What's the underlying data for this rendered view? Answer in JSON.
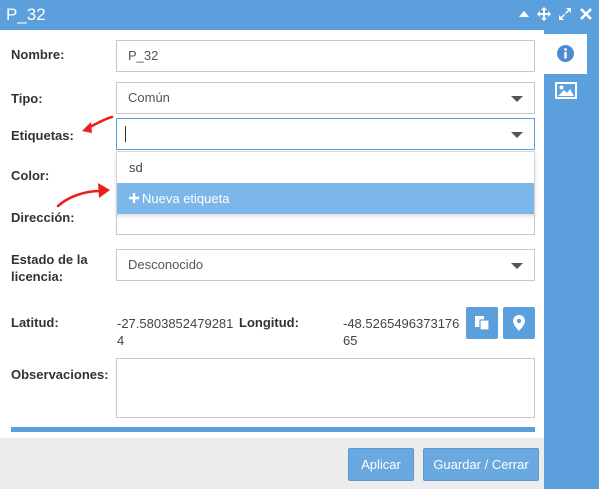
{
  "window": {
    "title": "P_32"
  },
  "form": {
    "nombre": {
      "label": "Nombre:",
      "value": "P_32"
    },
    "tipo": {
      "label": "Tipo:",
      "value": "Común"
    },
    "etiquetas": {
      "label": "Etiquetas:",
      "value": ""
    },
    "color": {
      "label": "Color:"
    },
    "direccion": {
      "label": "Dirección:"
    },
    "estado": {
      "label_line1": "Estado de la",
      "label_line2": "licencia:",
      "value": "Desconocido"
    },
    "latitud": {
      "label": "Latitud:",
      "value": "-27.58038524792814"
    },
    "longitud": {
      "label": "Longitud:",
      "value": "-48.526549637317665"
    },
    "observaciones": {
      "label": "Observaciones:",
      "value": ""
    }
  },
  "dropdown": {
    "items": [
      {
        "label": "sd"
      },
      {
        "label": "Nueva etiqueta",
        "icon": "plus-icon"
      }
    ]
  },
  "footer": {
    "apply_label": "Aplicar",
    "save_close_label": "Guardar / Cerrar"
  },
  "colors": {
    "accent": "#5b9fdc",
    "highlight": "#7db6e8",
    "arrow": "#e8221b"
  }
}
